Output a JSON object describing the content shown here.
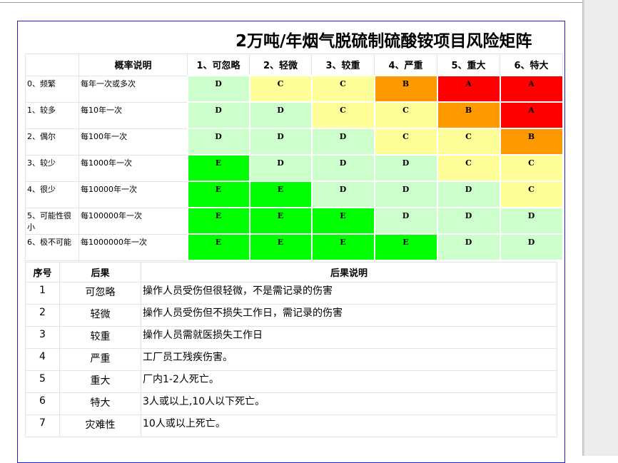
{
  "title": "2万吨/年烟气脱硫制硫酸铵项目风险矩阵",
  "matrix": {
    "header_prob": "概率说明",
    "severity_headers": [
      "1、可忽略",
      "2、轻微",
      "3、较重",
      "4、严重",
      "5、重大",
      "6、特大"
    ],
    "rows": [
      {
        "level": "0、频繁",
        "desc": "每年一次或多次",
        "ratings": [
          "D",
          "C",
          "C",
          "B",
          "A",
          "A"
        ]
      },
      {
        "level": "1、较多",
        "desc": "每10年一次",
        "ratings": [
          "D",
          "D",
          "C",
          "C",
          "B",
          "A"
        ]
      },
      {
        "level": "2、偶尔",
        "desc": "每100年一次",
        "ratings": [
          "D",
          "D",
          "D",
          "C",
          "C",
          "B"
        ]
      },
      {
        "level": "3、较少",
        "desc": "每1000年一次",
        "ratings": [
          "E",
          "D",
          "D",
          "D",
          "C",
          "C"
        ]
      },
      {
        "level": "4、很少",
        "desc": "每10000年一次",
        "ratings": [
          "E",
          "E",
          "D",
          "D",
          "D",
          "C"
        ]
      },
      {
        "level": "5、可能性很小",
        "desc": "每100000年一次",
        "ratings": [
          "E",
          "E",
          "E",
          "D",
          "D",
          "D"
        ]
      },
      {
        "level": "6、极不可能",
        "desc": "每1000000年一次",
        "ratings": [
          "E",
          "E",
          "E",
          "E",
          "D",
          "D"
        ]
      }
    ]
  },
  "rating_colors": {
    "A": "#ff0000",
    "B": "#ff9900",
    "C": "#ffff99",
    "D": "#ccffcc",
    "E": "#00ff00"
  },
  "consequences": {
    "headers": [
      "序号",
      "后果",
      "后果说明"
    ],
    "rows": [
      {
        "no": "1",
        "name": "可忽略",
        "desc": "操作人员受伤但很轻微，不是需记录的伤害"
      },
      {
        "no": "2",
        "name": "轻微",
        "desc": "操作人员受伤但不损失工作日，需记录的伤害"
      },
      {
        "no": "3",
        "name": "较重",
        "desc": "操作人员需就医损失工作日"
      },
      {
        "no": "4",
        "name": "严重",
        "desc": "工厂员工残疾伤害。"
      },
      {
        "no": "5",
        "name": "重大",
        "desc": "厂内1-2人死亡。"
      },
      {
        "no": "6",
        "name": "特大",
        "desc": "3人或以上,10人以下死亡。"
      },
      {
        "no": "7",
        "name": "灾难性",
        "desc": "10人或以上死亡。"
      }
    ]
  }
}
